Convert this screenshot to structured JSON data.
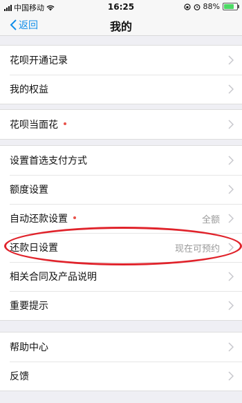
{
  "status_bar": {
    "carrier": "中国移动",
    "time": "16:25",
    "battery": "88%",
    "battery_level": 0.88
  },
  "nav": {
    "back_label": "返回",
    "title": "我的"
  },
  "groups": [
    {
      "items": [
        {
          "label": "花呗开通记录"
        },
        {
          "label": "我的权益"
        }
      ]
    },
    {
      "items": [
        {
          "label": "花呗当面花",
          "dot": true
        }
      ]
    },
    {
      "items": [
        {
          "label": "设置首选支付方式"
        },
        {
          "label": "额度设置"
        },
        {
          "label": "自动还款设置",
          "dot": true,
          "value": "全额"
        },
        {
          "label": "还款日设置",
          "value": "现在可预约"
        },
        {
          "label": "相关合同及产品说明"
        },
        {
          "label": "重要提示"
        }
      ]
    },
    {
      "items": [
        {
          "label": "帮助中心"
        },
        {
          "label": "反馈"
        }
      ]
    }
  ],
  "colors": {
    "accent": "#108ee9",
    "dot": "#e8524a",
    "highlight": "#e0232b"
  },
  "icons": {
    "back": "chevron-left-icon",
    "row": "chevron-right-icon"
  }
}
